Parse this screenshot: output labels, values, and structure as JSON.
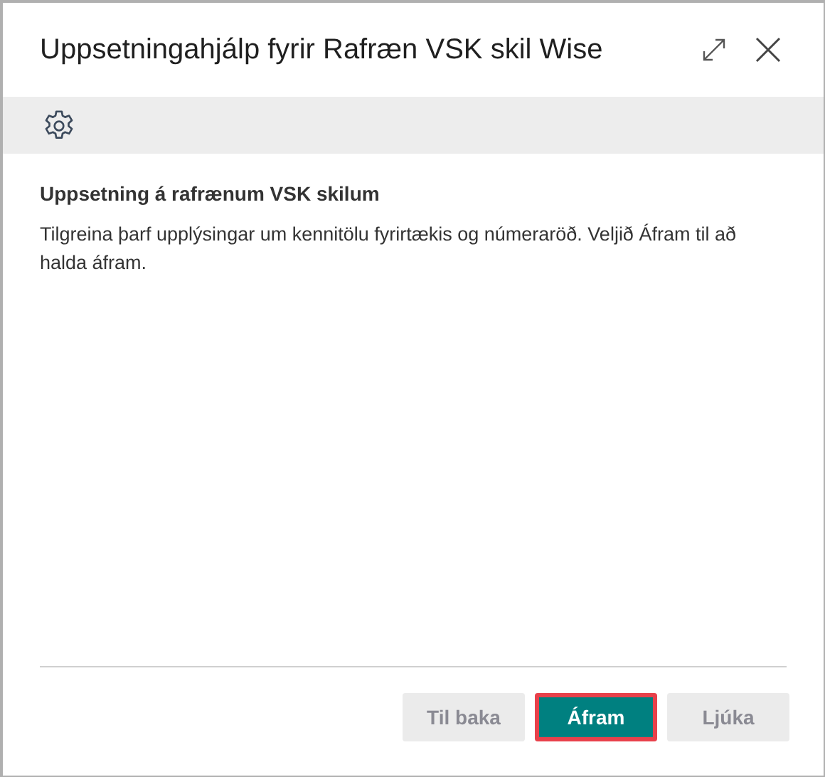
{
  "window": {
    "title": "Uppsetningahjálp fyrir Rafræn VSK skil Wise"
  },
  "content": {
    "heading": "Uppsetning á rafrænum VSK skilum",
    "text": "Tilgreina þarf upplýsingar um kennitölu fyrirtækis og númeraröð. Veljið Áfram til að halda áfram."
  },
  "buttons": [
    {
      "label": "Til baka",
      "disabled": true,
      "primary": false,
      "highlighted": false
    },
    {
      "label": "Áfram",
      "disabled": false,
      "primary": true,
      "highlighted": true
    },
    {
      "label": "Ljúka",
      "disabled": true,
      "primary": false,
      "highlighted": false
    }
  ]
}
